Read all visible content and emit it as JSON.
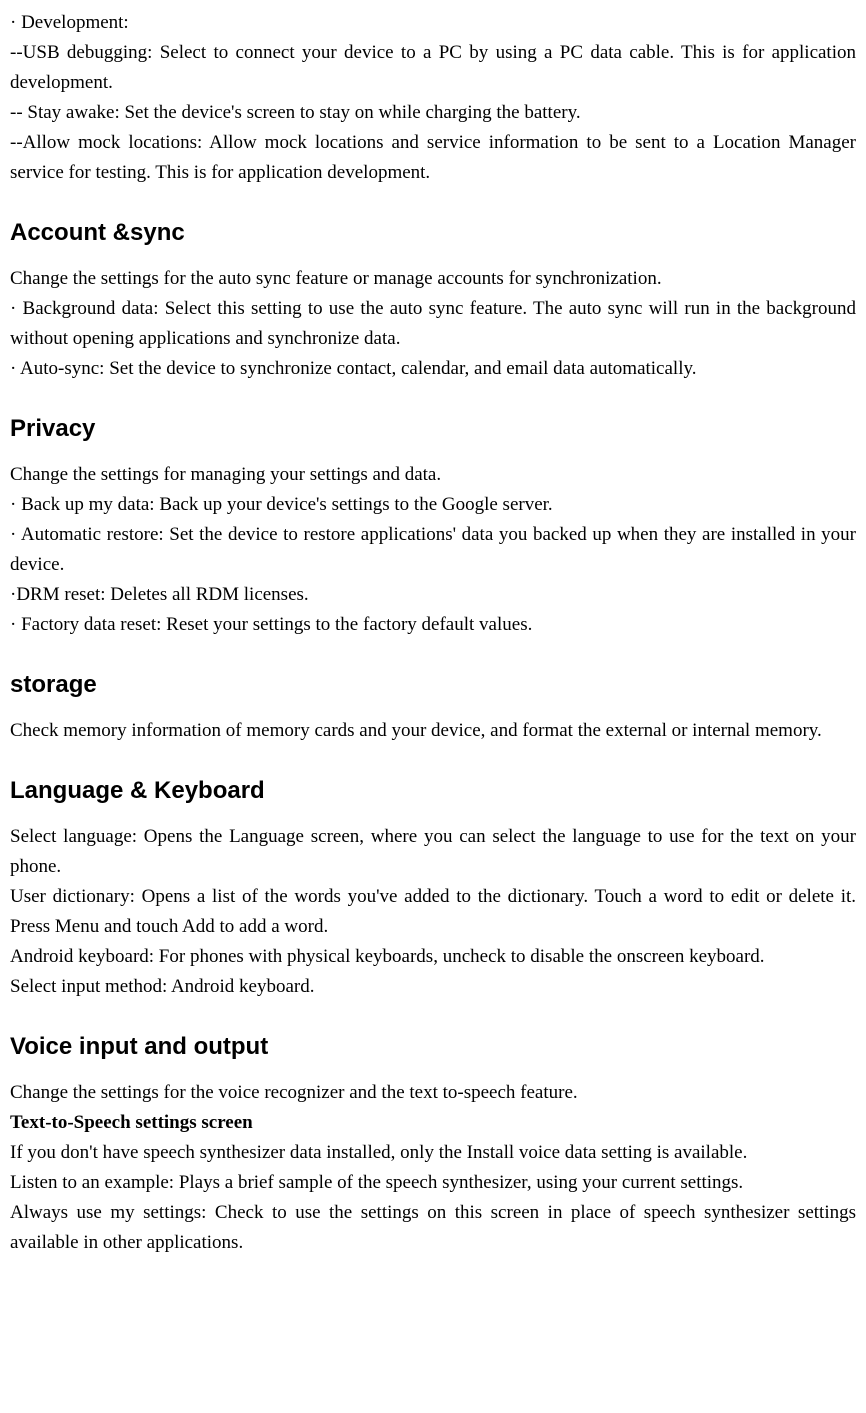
{
  "development": {
    "title": "· Development:",
    "usb": "--USB debugging: Select to connect your device to a PC by using a PC data cable. This is for application development.",
    "stay_awake": "-- Stay awake: Set the device's screen to stay on while charging the battery.",
    "mock": "--Allow mock locations: Allow mock locations and service information to be sent to a Location Manager service for testing. This is for application development."
  },
  "account_sync": {
    "heading": "Account &sync",
    "intro": "Change the settings for the auto sync feature or manage accounts for synchronization.",
    "background": "· Background data: Select this setting to use the auto sync feature. The auto sync will run in the background without opening applications and synchronize data.",
    "auto_sync": "· Auto-sync: Set the device to synchronize contact, calendar,   and email data automatically."
  },
  "privacy": {
    "heading": "Privacy",
    "intro": "Change the settings for managing your settings and data.",
    "backup": "· Back up my data: Back up your device's settings to the Google server.",
    "auto_restore": "· Automatic restore: Set the device to restore applications' data you backed up when they are installed in your device.",
    "drm": "·DRM reset: Deletes all RDM licenses.",
    "factory": "· Factory data reset: Reset your settings to the factory default values."
  },
  "storage": {
    "heading": "storage",
    "intro": "Check memory information of memory cards and your device, and format the external or internal memory."
  },
  "language_keyboard": {
    "heading": "Language & Keyboard",
    "select_language": "Select language: Opens the Language screen, where you can select the language to use for the text on your phone.",
    "user_dictionary": "User dictionary: Opens a list of the words you've added to the dictionary. Touch a word to edit or delete it. Press Menu and touch Add to add a word.",
    "android_keyboard": "Android keyboard: For phones with physical keyboards, uncheck to disable the onscreen keyboard.",
    "select_input": "Select input method: Android keyboard."
  },
  "voice": {
    "heading": "Voice input and output",
    "intro": "Change the settings for the voice recognizer and the text to-speech feature.",
    "tts_heading": "Text-to-Speech settings screen",
    "no_data": "If you don't have speech synthesizer data installed, only the Install voice data setting is available.",
    "listen": "Listen to an example: Plays a brief sample of the speech synthesizer, using your current settings.",
    "always_use": "Always use my settings: Check to use the settings on this screen in place of speech synthesizer settings available in other applications."
  }
}
